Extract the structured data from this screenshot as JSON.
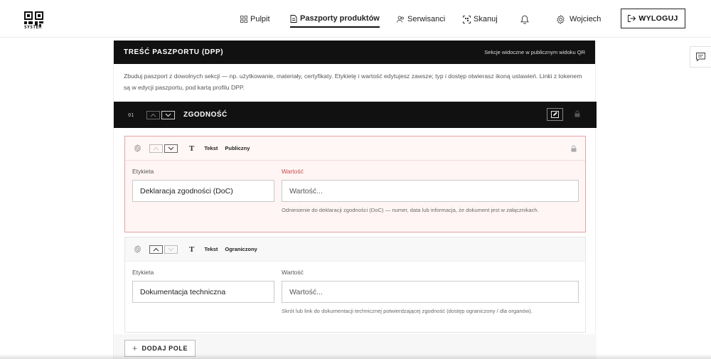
{
  "brand": {
    "logo_text": "SYSTEM",
    "logo_icon": "qr-logo-icon"
  },
  "nav": {
    "items": [
      {
        "label": "Pulpit",
        "icon": "grid-icon"
      },
      {
        "label": "Paszporty produktów",
        "icon": "document-icon",
        "active": true
      },
      {
        "label": "Serwisanci",
        "icon": "users-icon"
      },
      {
        "label": "Skanuj",
        "icon": "scan-icon"
      }
    ],
    "bell_icon": "bell-icon",
    "user": {
      "label": "Wojciech",
      "icon": "gear-icon"
    },
    "logout_label": "WYLOGUJ"
  },
  "side": {
    "icon": "comment-icon"
  },
  "panel": {
    "title": "TREŚĆ PASZPORTU (DPP)",
    "note": "Sekcje widoczne w publicznym widoku QR",
    "description": "Zbuduj paszport z dowolnych sekcji — np. użytkowanie, materiały, certyfikaty. Etykietę i wartość edytujesz zawsze; typ i dostęp otwierasz ikoną ustawień. Linki z tokenem są w edycji paszportu, pod kartą profilu DPP."
  },
  "section": {
    "number": "01",
    "title": "ZGODNOŚĆ"
  },
  "fields": [
    {
      "type_symbol": "T",
      "type_label": "Tekst",
      "access_label": "Publiczny",
      "label_caption": "Etykieta",
      "label_value": "Deklaracja zgodności (DoC)",
      "value_caption": "Wartość",
      "value_placeholder": "Wartość...",
      "hint": "Odniesienie do deklaracji zgodności (DoC) — numer, data lub informacja, że dokument jest w załącznikach.",
      "state": "error"
    },
    {
      "type_symbol": "T",
      "type_label": "Tekst",
      "access_label": "Ograniczony",
      "label_caption": "Etykieta",
      "label_value": "Dokumentacja techniczna",
      "value_caption": "Wartość",
      "value_placeholder": "Wartość...",
      "hint": "Skrót lub link do dokumentacji technicznej potwierdzającej zgodność (dostęp ograniczony / dla organów).",
      "state": "normal"
    }
  ],
  "add_field_label": "DODAJ POLE",
  "colors": {
    "accent_dark": "#111111",
    "error_border": "#e8a2a2",
    "error_text": "#c94747",
    "error_bg": "#fff5f5"
  }
}
